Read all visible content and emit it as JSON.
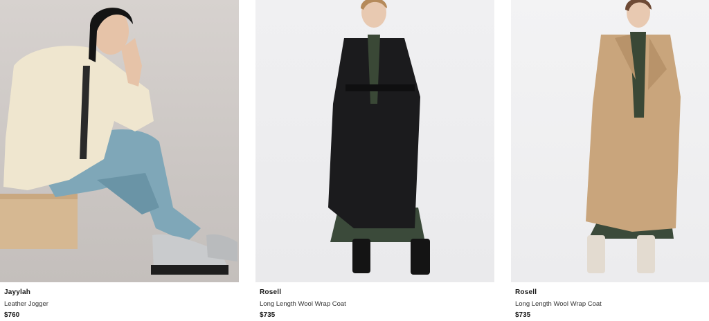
{
  "products": [
    {
      "name": "Jayylah",
      "description": "Leather Jogger",
      "price": "$760",
      "image_icon": "product-photo-leather-jogger"
    },
    {
      "name": "Rosell",
      "description": "Long Length Wool Wrap Coat",
      "price": "$735",
      "image_icon": "product-photo-black-wrap-coat"
    },
    {
      "name": "Rosell",
      "description": "Long Length Wool Wrap Coat",
      "price": "$735",
      "image_icon": "product-photo-camel-wrap-coat"
    }
  ],
  "colors": {
    "text": "#1a1a1a",
    "jogger_blue": "#7fa7b8",
    "cardigan_cream": "#efe6cf",
    "coat_black": "#1b1b1d",
    "coat_camel": "#c9a57c"
  }
}
